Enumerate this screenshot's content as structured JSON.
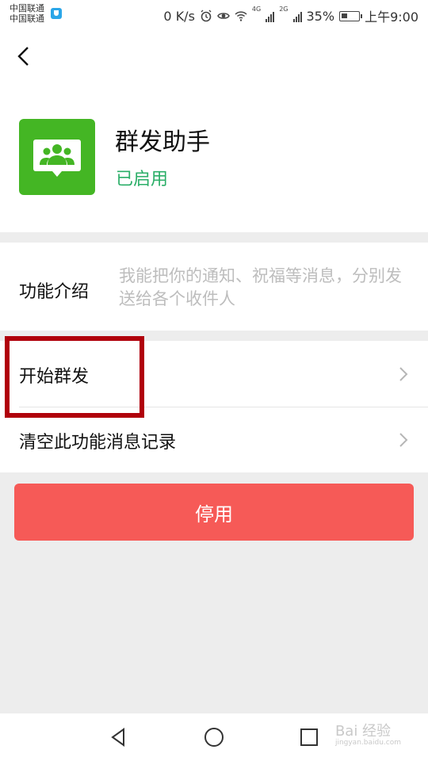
{
  "status_bar": {
    "carrier1": "中国联通",
    "carrier2": "中国联通",
    "speed": "0 K/s",
    "net1": "4G",
    "net2": "2G",
    "battery": "35%",
    "time": "上午9:00",
    "battery_level": 0.35
  },
  "header": {
    "app_title": "群发助手",
    "app_status": "已启用"
  },
  "intro": {
    "label": "功能介绍",
    "text": "我能把你的通知、祝福等消息，分别发送给各个收件人"
  },
  "list": {
    "items": [
      {
        "label": "开始群发"
      },
      {
        "label": "清空此功能消息记录"
      }
    ]
  },
  "disable_button": "停用",
  "watermark": {
    "text": "Bai 经验",
    "sub": "jingyan.baidu.com"
  },
  "colors": {
    "accent_green": "#2aae67",
    "icon_green": "#44b624",
    "button_red": "#f65a57",
    "highlight": "#b0000b"
  },
  "icons": [
    "back-icon",
    "group-chat-icon",
    "chevron-right-icon",
    "nav-back-icon",
    "nav-home-icon",
    "nav-recent-icon",
    "alarm-icon",
    "eye-icon",
    "wifi-icon"
  ]
}
